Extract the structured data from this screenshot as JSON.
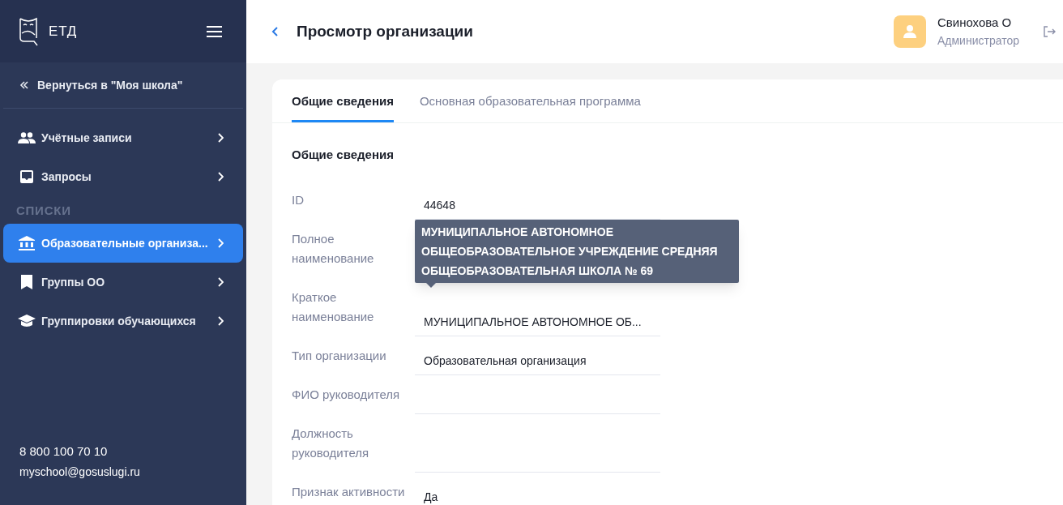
{
  "sidebar": {
    "logo": "ЕТД",
    "back_link": "Вернуться в \"Моя школа\"",
    "items": [
      {
        "label": "Учётные записи",
        "kind": "people",
        "selected": false
      },
      {
        "label": "Запросы",
        "kind": "inbox",
        "selected": false
      }
    ],
    "section": "СПИСКИ",
    "list_items": [
      {
        "label": "Образовательные организа...",
        "kind": "building",
        "selected": true
      },
      {
        "label": "Группы ОО",
        "kind": "bookmark",
        "selected": false
      },
      {
        "label": "Группировки обучающихся",
        "kind": "cap",
        "selected": false
      }
    ],
    "phone": "8 800 100 70 10",
    "email": "myschool@gosuslugi.ru"
  },
  "header": {
    "title": "Просмотр организации",
    "user_name": "Свинохова О",
    "user_role": "Администратор"
  },
  "tabs": [
    {
      "label": "Общие сведения",
      "selected": true
    },
    {
      "label": "Основная образовательная программа",
      "selected": false
    }
  ],
  "section_title": "Общие сведения",
  "fields": [
    {
      "label": "ID",
      "value": "44648"
    },
    {
      "label": "Полное наименование"
    },
    {
      "label": "Краткое наименование",
      "value": "МУНИЦИПАЛЬНОЕ АВТОНОМНОЕ ОБ..."
    },
    {
      "label": "Тип организации",
      "value": "Образовательная организация"
    },
    {
      "label": "ФИО руководителя"
    },
    {
      "label": "Должность руководителя"
    },
    {
      "label": "Признак активности",
      "value": "Да"
    }
  ],
  "tooltip": "МУНИЦИПАЛЬНОЕ АВТОНОМНОЕ ОБЩЕОБРАЗОВАТЕЛЬНОЕ УЧРЕЖДЕНИЕ СРЕДНЯЯ ОБЩЕОБРАЗОВАТЕЛЬНАЯ ШКОЛА № 69"
}
